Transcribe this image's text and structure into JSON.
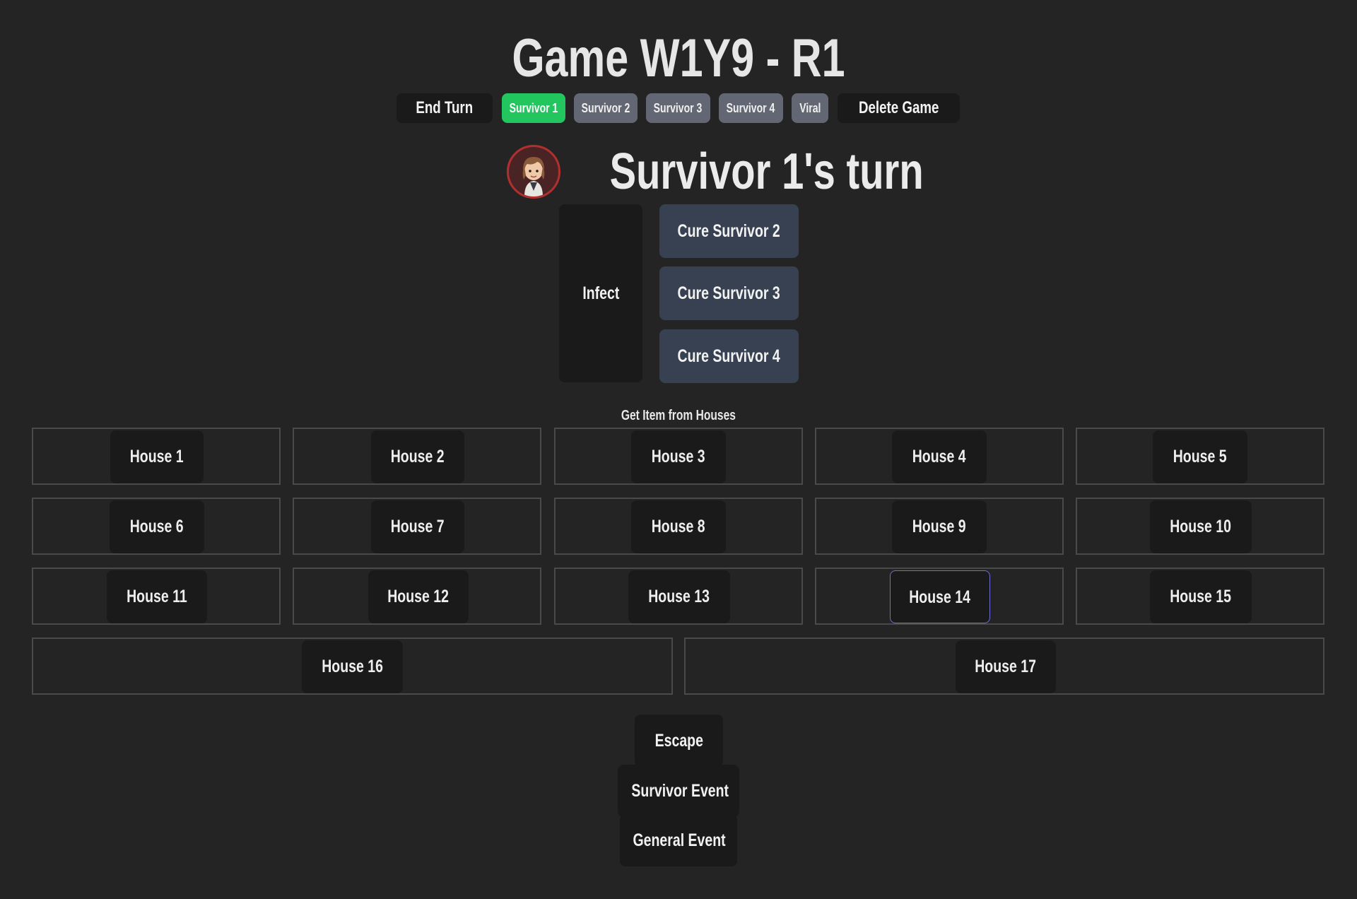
{
  "game": {
    "title": "Game W1Y9 - R1"
  },
  "top_bar": {
    "end_turn_label": "End Turn",
    "tabs": [
      {
        "label": "Survivor 1",
        "active": true
      },
      {
        "label": "Survivor 2",
        "active": false
      },
      {
        "label": "Survivor 3",
        "active": false
      },
      {
        "label": "Survivor 4",
        "active": false
      },
      {
        "label": "Viral",
        "active": false
      }
    ],
    "delete_label": "Delete Game"
  },
  "turn": {
    "avatar_icon": "survivor-portrait",
    "title": "Survivor 1's turn"
  },
  "actions": {
    "infect_label": "Infect",
    "cure_buttons": [
      "Cure Survivor 2",
      "Cure Survivor 3",
      "Cure Survivor 4"
    ]
  },
  "houses": {
    "section_label": "Get Item from Houses",
    "items": [
      "House 1",
      "House 2",
      "House 3",
      "House 4",
      "House 5",
      "House 6",
      "House 7",
      "House 8",
      "House 9",
      "House 10",
      "House 11",
      "House 12",
      "House 13",
      "House 14",
      "House 15",
      "House 16",
      "House 17"
    ],
    "focused": "House 14"
  },
  "bottom": {
    "escape_label": "Escape",
    "survivor_event_label": "Survivor Event",
    "general_event_label": "General Event"
  },
  "colors": {
    "background": "#242424",
    "active_tab": "#22c55e",
    "inactive_tab": "#636773",
    "cure_button": "#374151",
    "dark_button": "#1a1a1a",
    "focus_ring": "#6d6dd6"
  }
}
